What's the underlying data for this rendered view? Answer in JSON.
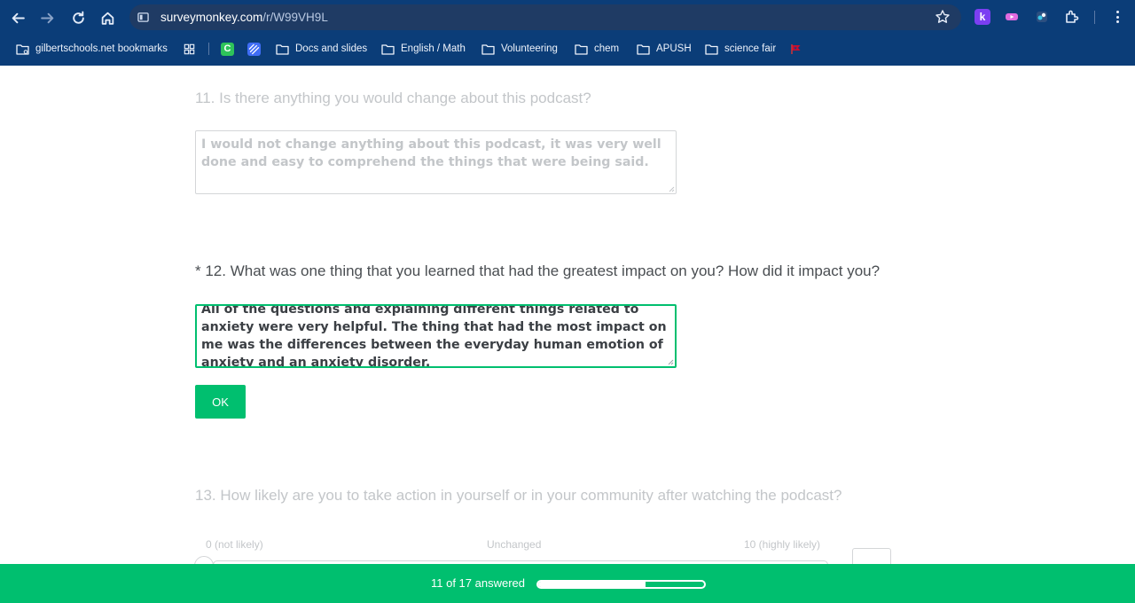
{
  "browser": {
    "url_domain": "surveymonkey.com",
    "url_path": "/r/W99VH9L",
    "extension_k_label": "k"
  },
  "bookmarks": [
    {
      "label": "gilbertschools.net bookmarks"
    },
    {
      "label": "Docs and slides"
    },
    {
      "label": "English / Math"
    },
    {
      "label": "Volunteering"
    },
    {
      "label": "chem"
    },
    {
      "label": "APUSH"
    },
    {
      "label": "science fair"
    }
  ],
  "bookmark_icons": {
    "classroom_letter": "C"
  },
  "survey": {
    "q11": {
      "title": "11. Is there anything you would change about this podcast?",
      "answer": "I would not change anything about this podcast, it was very well done and easy to comprehend the things that were being said."
    },
    "q12": {
      "title": "* 12. What was one thing that you learned that had the greatest impact on you? How did it impact you?",
      "answer_partial": "All of the questions and explaining different things related to",
      "answer": "anxiety were very helpful. The thing that had the most impact on me was the differences between the everyday human emotion of anxiety and an anxiety disorder.",
      "ok_label": "OK"
    },
    "q13": {
      "title": "13. How likely are you to take action in yourself or in your community after watching the podcast?",
      "scale_min": "0 (not likely)",
      "scale_mid": "Unchanged",
      "scale_max": "10 (highly likely)"
    }
  },
  "progress": {
    "text": "11 of 17 answered",
    "answered": 11,
    "total": 17,
    "fraction": 0.647
  },
  "colors": {
    "chrome_bg": "#0b3d78",
    "accent_green": "#00bf6f"
  }
}
